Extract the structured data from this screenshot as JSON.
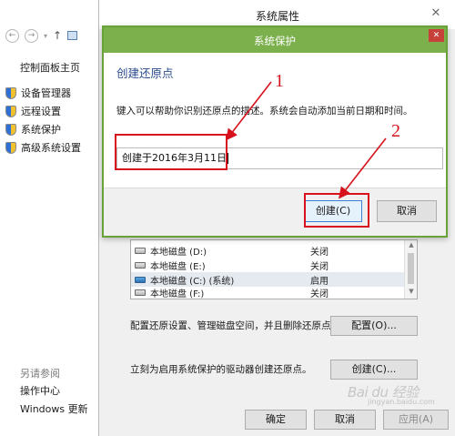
{
  "control_panel": {
    "home_link": "控制面板主页",
    "links": [
      "设备管理器",
      "远程设置",
      "系统保护",
      "高级系统设置"
    ],
    "see_also_heading": "另请参阅",
    "see_also_links": [
      "操作中心",
      "Windows 更新"
    ]
  },
  "system_properties": {
    "title": "系统属性",
    "close_glyph": "✕",
    "drives": [
      {
        "name": "本地磁盘 (D:)",
        "state": "关闭"
      },
      {
        "name": "本地磁盘 (E:)",
        "state": "关闭"
      },
      {
        "name": "本地磁盘 (C:) (系统)",
        "state": "启用"
      },
      {
        "name": "本地磁盘 (F:)",
        "state": "关闭"
      }
    ],
    "configure_text": "配置还原设置、管理磁盘空间，并且删除还原点。",
    "configure_button": "配置(O)...",
    "create_text": "立刻为启用系统保护的驱动器创建还原点。",
    "create_button": "创建(C)...",
    "ok_button": "确定",
    "cancel_button": "取消",
    "apply_button": "应用(A)"
  },
  "dialog": {
    "title": "系统保护",
    "close_glyph": "✕",
    "heading": "创建还原点",
    "description": "键入可以帮助你识别还原点的描述。系统会自动添加当前日期和时间。",
    "input_value": "创建于2016年3月11日",
    "create_button": "创建(C)",
    "cancel_button": "取消"
  },
  "annotations": {
    "step1": "1",
    "step2": "2",
    "color": "#d8121c"
  },
  "watermark": {
    "text": "Bai du 经验",
    "sub": "jingyan.baidu.com"
  },
  "colors": {
    "dialog_title_bar": "#7bb04c",
    "dialog_border": "#6aa23a",
    "heading_blue": "#2a4b8d"
  }
}
